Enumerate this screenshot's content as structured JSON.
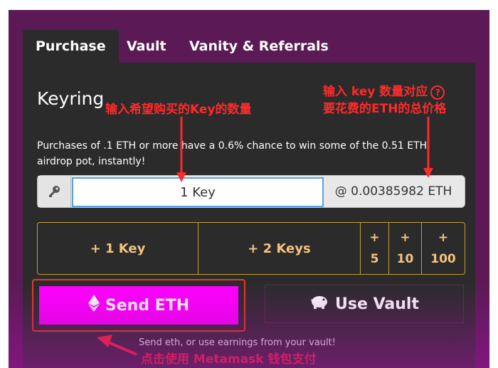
{
  "tabs": [
    {
      "label": "Purchase"
    },
    {
      "label": "Vault"
    },
    {
      "label": "Vanity & Referrals"
    }
  ],
  "panel": {
    "title": "Keyring",
    "description": "Purchases of .1 ETH or more have a 0.6% chance to win some of the 0.51 ETH airdrop pot, instantly!",
    "key_input_value": "1 Key",
    "eth_price": "@ 0.00385982 ETH",
    "quick_buttons": {
      "plus1": "+ 1 Key",
      "plus2": "+ 2 Keys",
      "plus5_sign": "+",
      "plus5_num": "5",
      "plus10_sign": "+",
      "plus10_num": "10",
      "plus100_sign": "+",
      "plus100_num": "100"
    },
    "send_label": "Send ETH",
    "vault_label": "Use Vault",
    "hint": "Send eth, or use earnings from your vault!"
  },
  "annotations": {
    "input_keys": "输入希望购买的Key的数量",
    "eth_line1": "输入 key 数量对应",
    "eth_line2": "要花费的ETH的总价格",
    "metamask": "点击使用 Metamask 钱包支付",
    "help_glyph": "?"
  },
  "colors": {
    "background_purple": "#5b1a55",
    "panel": "#2b2b2b",
    "send_button": "#ff00ff",
    "quick_text": "#f4c37d",
    "quick_border": "#c99d2e",
    "annotation_red": "#ff2a2a"
  },
  "icons": {
    "key": "key-icon",
    "ethereum": "ethereum-icon",
    "piggy_bank": "piggy-bank-icon"
  }
}
